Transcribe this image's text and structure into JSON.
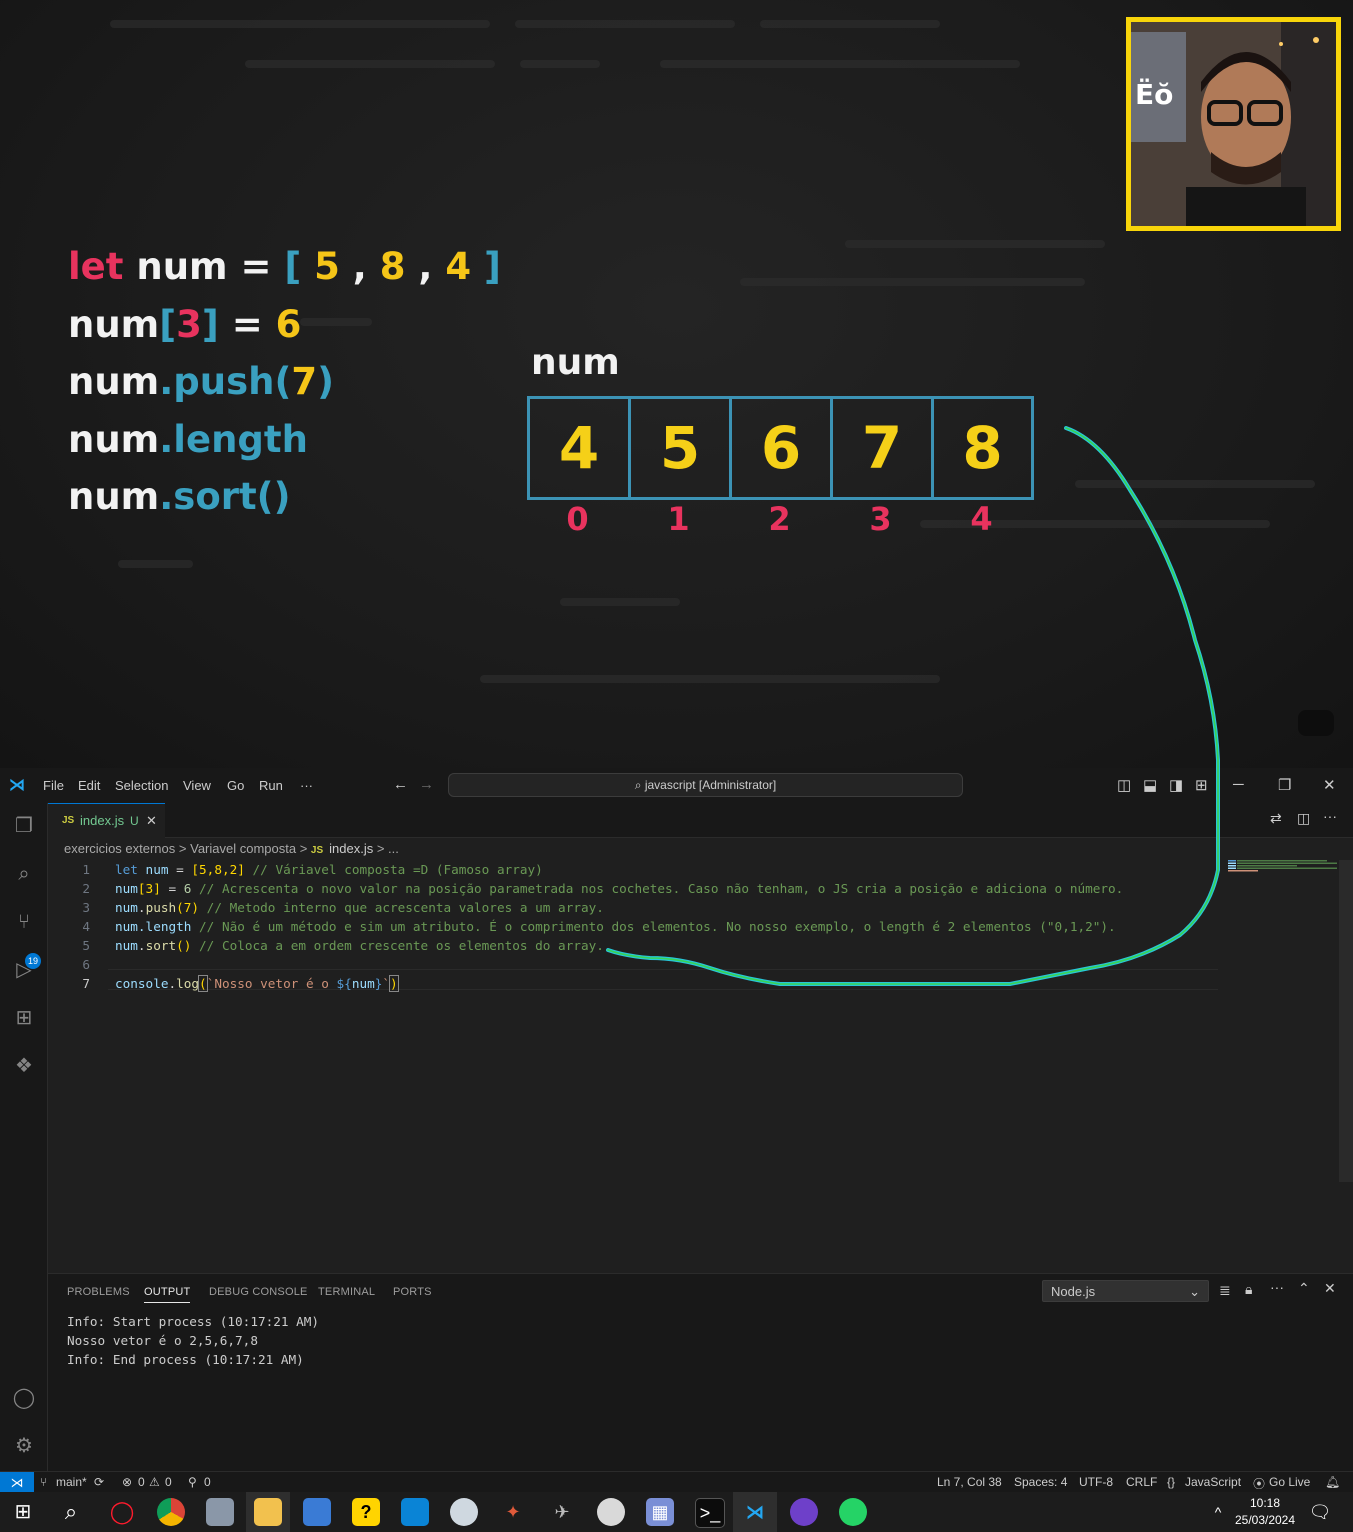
{
  "video": {
    "code_lines": [
      {
        "a": "let",
        "b": " num = ",
        "c": "[",
        "d": " 5 ",
        "e": ",",
        "f": " 8 ",
        "g": ",",
        "h": " 4 ",
        "i": "]"
      },
      {
        "a": "num",
        "b": "[",
        "c": "3",
        "d": "]",
        "e": " = ",
        "f": "6"
      },
      {
        "a": "num",
        "b": ".push(",
        "c": "7",
        "d": ")"
      },
      {
        "a": "num",
        "b": ".length"
      },
      {
        "a": "num",
        "b": ".sort()"
      }
    ],
    "array_name": "num",
    "array_values": [
      "4",
      "5",
      "6",
      "7",
      "8"
    ],
    "array_indices": [
      "0",
      "1",
      "2",
      "3",
      "4"
    ]
  },
  "titlebar": {
    "menu": [
      "File",
      "Edit",
      "Selection",
      "View",
      "Go",
      "Run",
      "···"
    ],
    "command_center": "javascript [Administrator]"
  },
  "tab": {
    "lang_icon": "JS",
    "label": "index.js",
    "status": "U",
    "close": "✕"
  },
  "breadcrumb": {
    "part1": "exercicios externos",
    "sep": " > ",
    "part2": "Variavel composta",
    "lang_icon": "JS",
    "file": "index.js",
    "tail": " > ..."
  },
  "editor": {
    "line_numbers": [
      "1",
      "2",
      "3",
      "4",
      "5",
      "6",
      "7"
    ],
    "lines": {
      "l1": {
        "kw": "let",
        "var": " num",
        "op": " = ",
        "arr": "[5,8,2]",
        "comment": " // Váriavel composta =D (Famoso array)"
      },
      "l2": {
        "var": "num",
        "idx": "[3]",
        "op": " = ",
        "num": "6",
        "comment": " // Acrescenta o novo valor na posição parametrada nos cochetes. Caso não tenham, o JS cria a posição e adiciona o número."
      },
      "l3": {
        "var": "num",
        "dot": ".",
        "fn": "push",
        "args": "(7)",
        "comment": " // Metodo interno que acrescenta valores a um array."
      },
      "l4": {
        "var": "num",
        "prop": ".length",
        "comment": " // Não é um método e sim um atributo. É o comprimento dos elementos. No nosso exemplo, o length é 2 elementos (\"0,1,2\")."
      },
      "l5": {
        "var": "num",
        "dot": ".",
        "fn": "sort",
        "args": "()",
        "comment": " // Coloca a em ordem crescente os elementos do array."
      },
      "l7": {
        "obj": "console",
        "dot": ".",
        "fn": "log",
        "paren_open": "(",
        "str1": "`Nosso vetor é o ",
        "interp_open": "${",
        "interp_var": "num",
        "interp_close": "}",
        "str2": "`",
        "paren_close": ")"
      }
    },
    "active_line": "7"
  },
  "panel": {
    "tabs": [
      "PROBLEMS",
      "OUTPUT",
      "DEBUG CONSOLE",
      "TERMINAL",
      "PORTS"
    ],
    "active_tab": "OUTPUT",
    "output_channel": "Node.js",
    "output_lines": [
      "Info: Start process (10:17:21 AM)",
      "Nosso vetor é o 2,5,6,7,8",
      "Info: End process (10:17:21 AM)"
    ]
  },
  "activity_badge": "19",
  "statusbar": {
    "branch": "main*",
    "errors": "0",
    "warnings": "0",
    "ports": "0",
    "position": "Ln 7, Col 38",
    "spaces": "Spaces: 4",
    "encoding": "UTF-8",
    "eol": "CRLF",
    "language": "JavaScript",
    "golive": "Go Live"
  },
  "taskbar": {
    "time": "10:18",
    "date": "25/03/2024"
  },
  "colors": {
    "accent": "#0078d4",
    "highlight_yellow": "#f5d018",
    "index_pink": "#e8335e",
    "array_border": "#3c93b5",
    "arrow_green": "#39d353"
  }
}
